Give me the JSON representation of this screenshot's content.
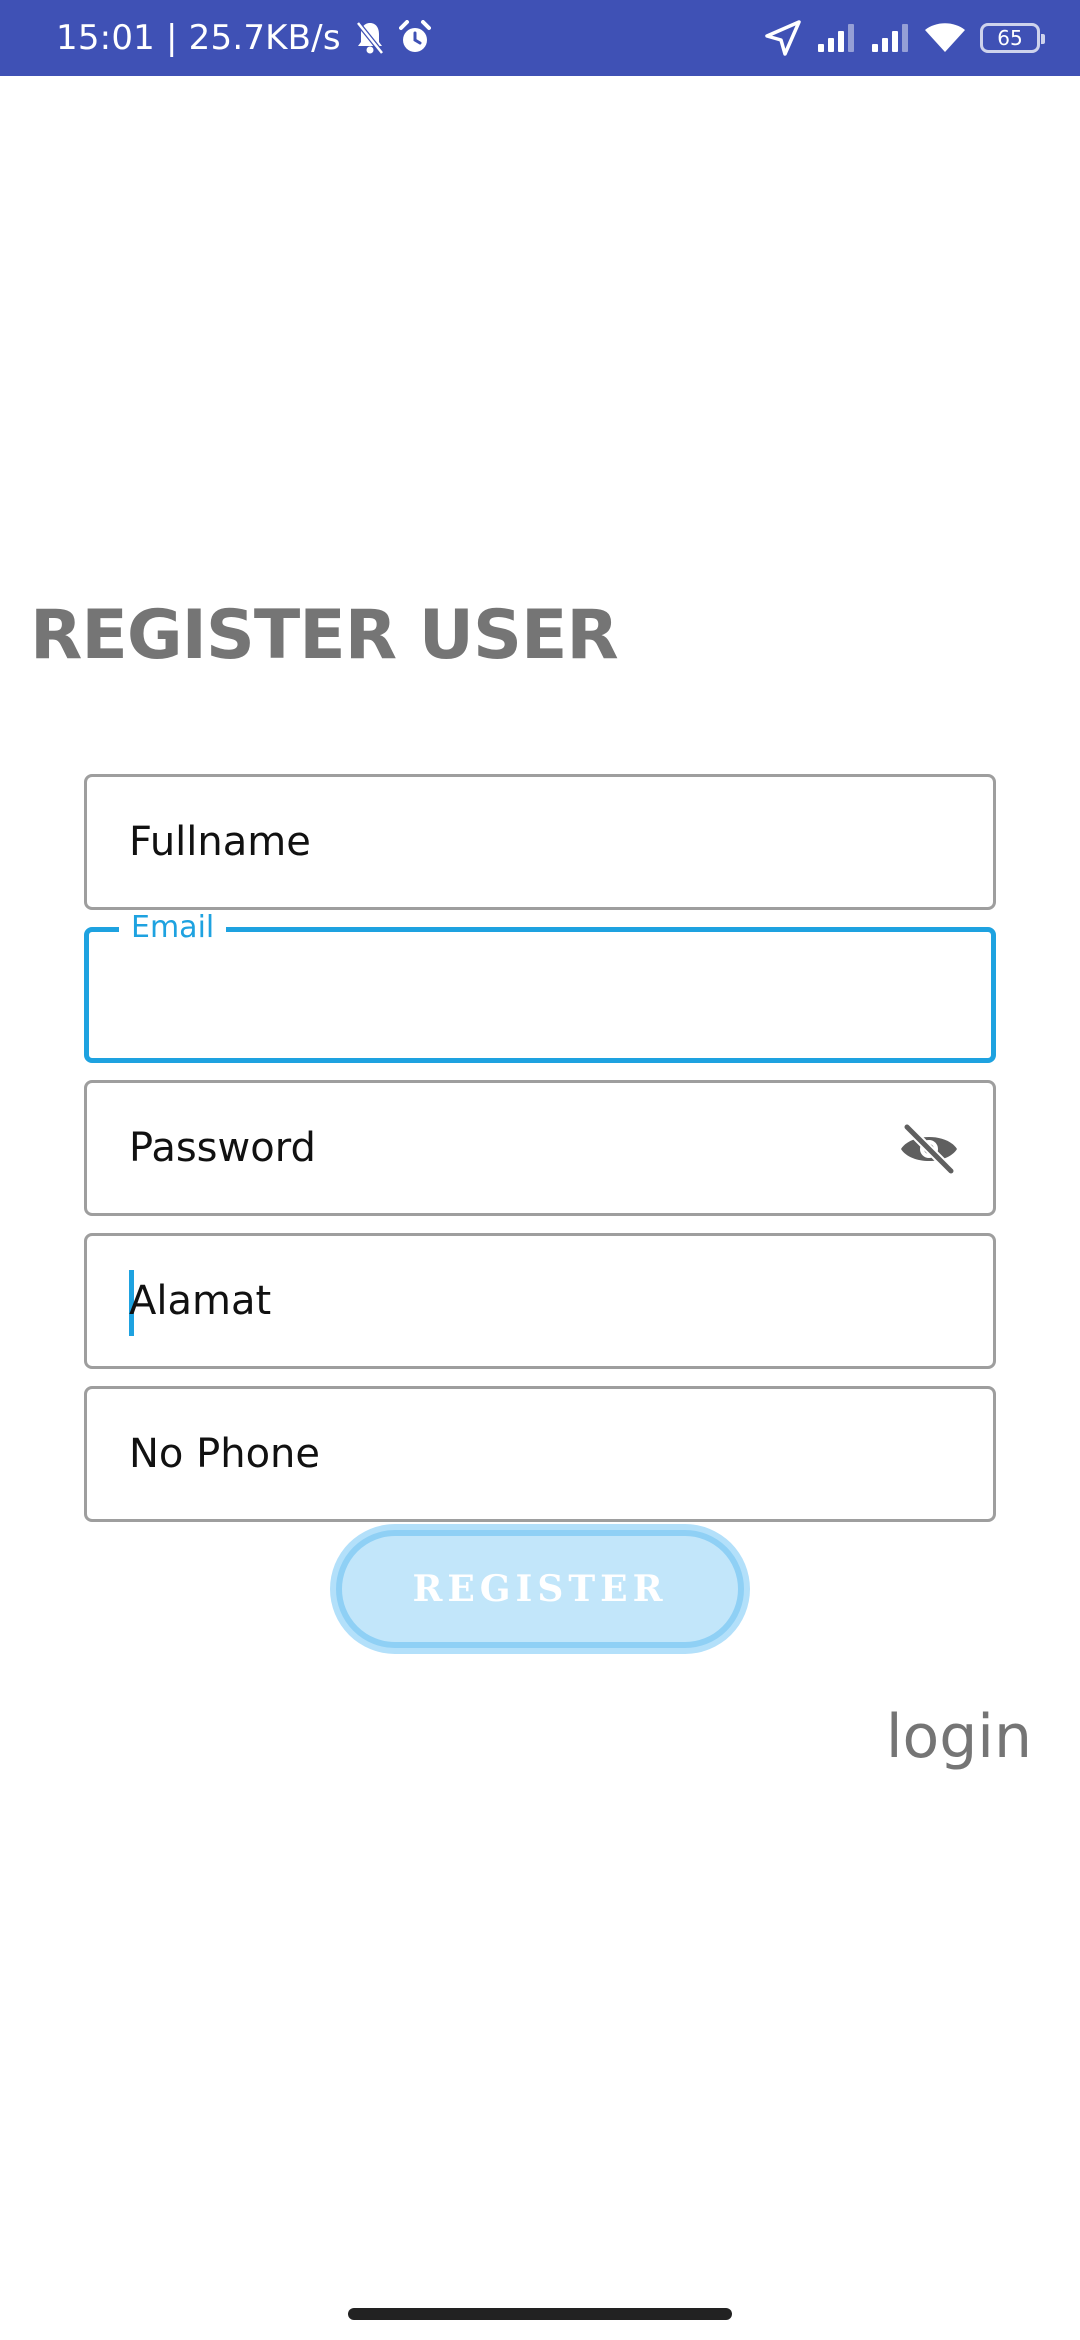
{
  "status_bar": {
    "time_speed": "15:01 | 25.7KB/s",
    "battery": "65",
    "icons": [
      "bell-muted-icon",
      "alarm-icon",
      "location-arrow-icon",
      "signal-icon",
      "signal-icon",
      "wifi-icon",
      "battery-icon"
    ],
    "background": "#3f51b5"
  },
  "page": {
    "title": "REGISTER USER"
  },
  "form": {
    "fullname_label": "Fullname",
    "email_label": "Email",
    "email_value": "",
    "password_label": "Password",
    "address_label": "Alamat",
    "phone_label": "No Phone",
    "focus_color": "#1ea2e0"
  },
  "actions": {
    "register_label": "REGISTER",
    "login_label": "login"
  }
}
